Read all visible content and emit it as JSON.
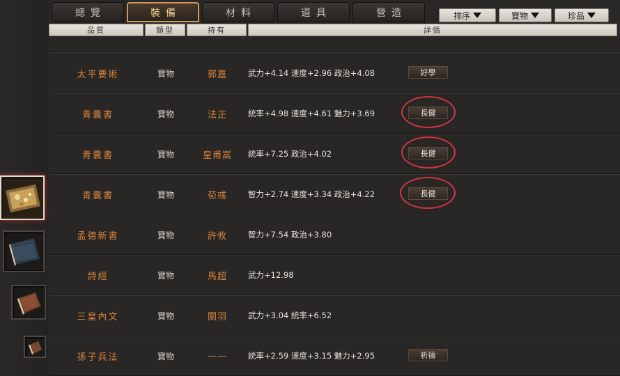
{
  "tabs": [
    {
      "label": "總覽",
      "active": false
    },
    {
      "label": "裝備",
      "active": true
    },
    {
      "label": "材料",
      "active": false
    },
    {
      "label": "道具",
      "active": false
    },
    {
      "label": "營造",
      "active": false
    }
  ],
  "filters": {
    "sort_label": "排序",
    "type_label": "寶物",
    "rarity_label": "珍品"
  },
  "columns": {
    "quality": "品質",
    "type": "類型",
    "owner": "持有",
    "details": "詳情"
  },
  "rows": [
    {
      "name": "太平要術",
      "type": "寶物",
      "owner": "郭嘉",
      "details": "武力+4.14  速度+2.96  政治+4.08",
      "badge": "好學",
      "highlighted": false
    },
    {
      "name": "青囊書",
      "type": "寶物",
      "owner": "法正",
      "details": "統率+4.98  速度+4.61  魅力+3.69",
      "badge": "長健",
      "highlighted": true
    },
    {
      "name": "青囊書",
      "type": "寶物",
      "owner": "皇甫嵩",
      "details": "統率+7.25  政治+4.02",
      "badge": "長健",
      "highlighted": true
    },
    {
      "name": "青囊書",
      "type": "寶物",
      "owner": "荀彧",
      "details": "智力+2.74  速度+3.34  政治+4.22",
      "badge": "長健",
      "highlighted": true
    },
    {
      "name": "孟德新書",
      "type": "寶物",
      "owner": "許攸",
      "details": "智力+7.54  政治+3.80",
      "badge": "",
      "highlighted": false
    },
    {
      "name": "詩經",
      "type": "寶物",
      "owner": "馬超",
      "details": "武力+12.98",
      "badge": "",
      "highlighted": false
    },
    {
      "name": "三皇內文",
      "type": "寶物",
      "owner": "關羽",
      "details": "武力+3.04  統率+6.52",
      "badge": "",
      "highlighted": false
    },
    {
      "name": "孫子兵法",
      "type": "寶物",
      "owner": "——",
      "details": "統率+2.59  速度+3.15  魅力+2.95",
      "badge": "祈禱",
      "highlighted": false
    }
  ],
  "side_items": [
    {
      "icon": "treasure-box-icon",
      "selected": true
    },
    {
      "icon": "book-stack-icon",
      "selected": false
    },
    {
      "icon": "book-icon",
      "selected": false
    },
    {
      "icon": "small-book-icon",
      "selected": false
    }
  ],
  "colors": {
    "name_orange": "#d8823a",
    "active_tab_border": "#d09a5a",
    "highlight_circle": "#d0353f"
  }
}
